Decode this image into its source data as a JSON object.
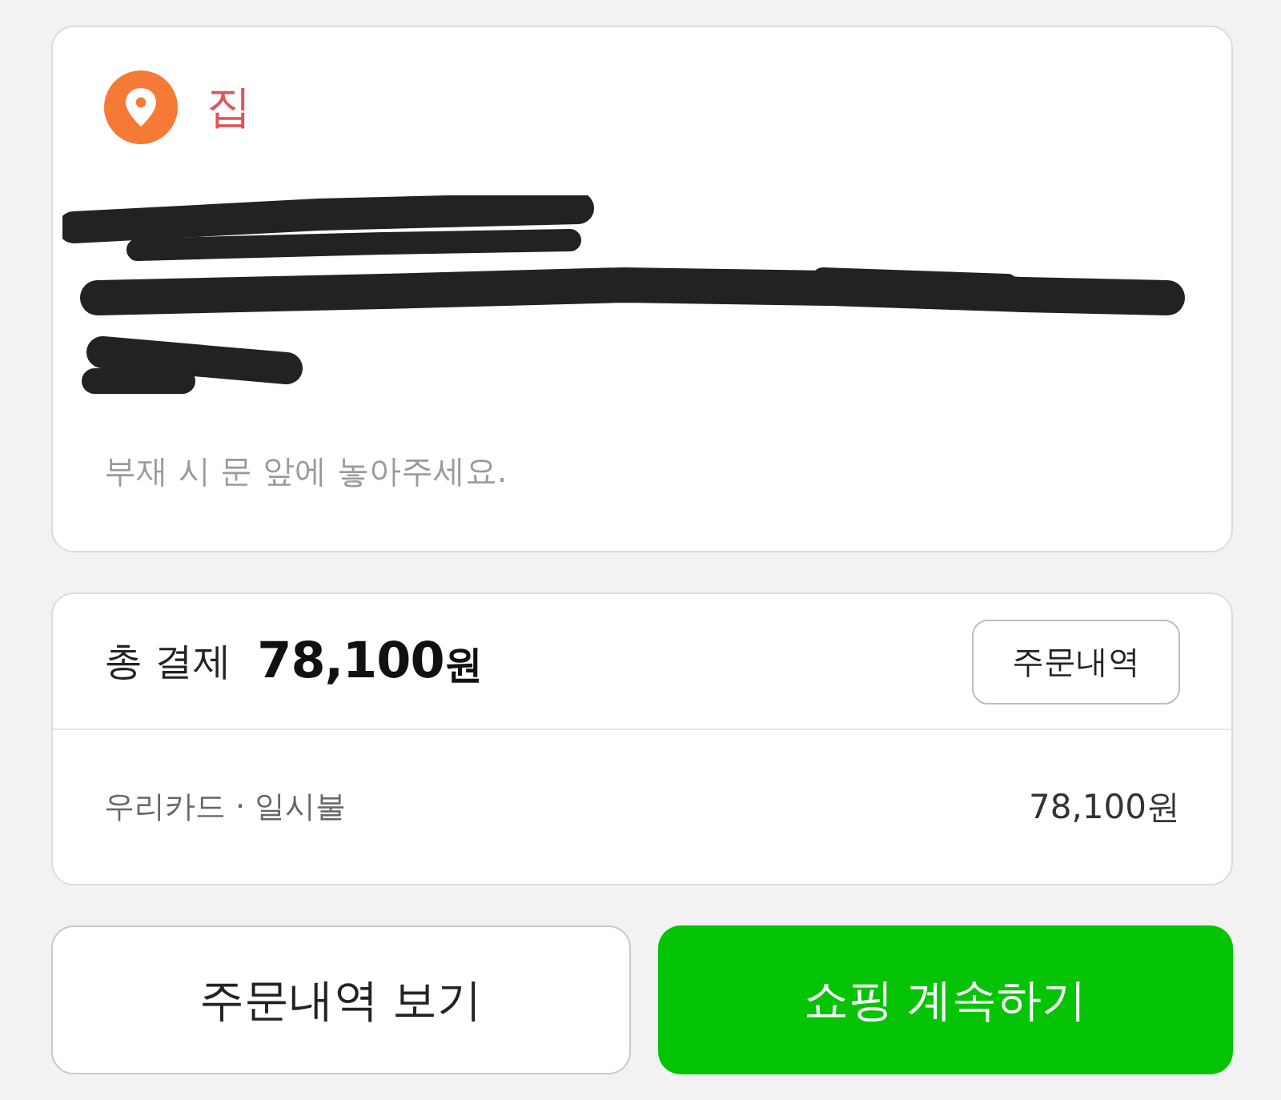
{
  "destination": {
    "label": "집",
    "address_redacted": true,
    "note": "부재 시 문 앞에 놓아주세요."
  },
  "payment": {
    "total_label": "총 결제",
    "total_amount": "78,100",
    "total_unit": "원",
    "history_button": "주문내역",
    "method": "우리카드 · 일시불",
    "amount": "78,100원"
  },
  "actions": [
    {
      "label": "주문내역 보기",
      "kind": "secondary"
    },
    {
      "label": "쇼핑 계속하기",
      "kind": "primary"
    }
  ]
}
